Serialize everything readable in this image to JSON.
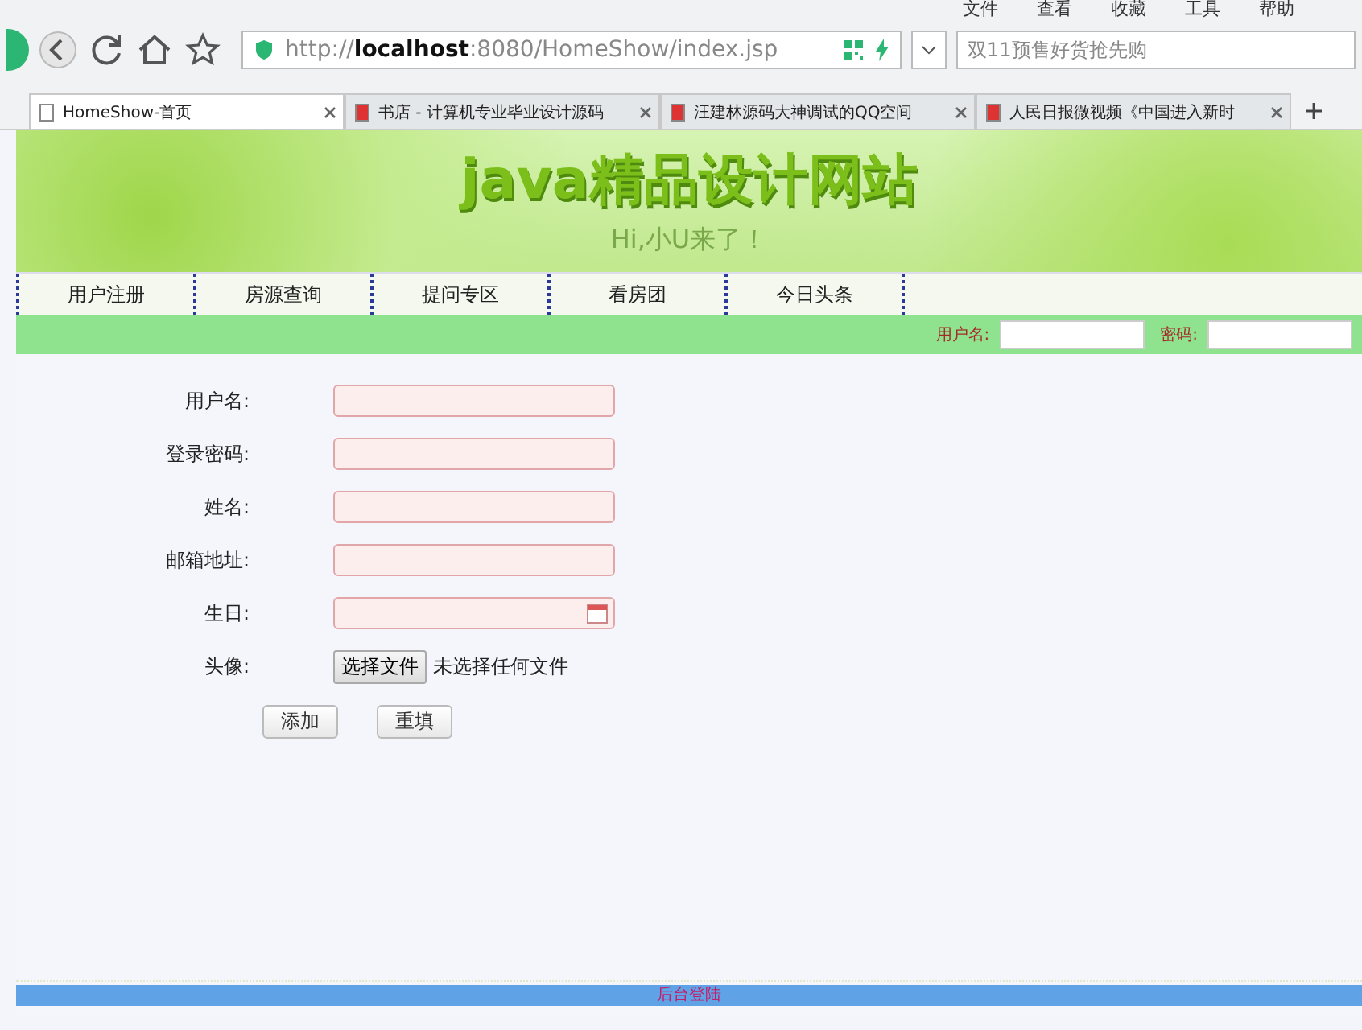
{
  "menu_bar": [
    "文件",
    "查看",
    "收藏",
    "工具",
    "帮助"
  ],
  "address_bar": {
    "url": "http://**localhost**:8080/HomeShow/index.jsp"
  },
  "search": {
    "placeholder": "双11预售好货抢先购"
  },
  "tabs": [
    {
      "label": "HomeShow-首页",
      "selected": true
    },
    {
      "label": "书店 - 计算机专业毕业设计源码",
      "selected": false
    },
    {
      "label": "汪建林源码大神调试的QQ空间",
      "selected": false
    },
    {
      "label": "人民日报微视频《中国进入新时",
      "selected": false
    }
  ],
  "banner": {
    "title": "java精品设计网站",
    "subtitle": "Hi,小U来了！"
  },
  "nav": [
    "用户注册",
    "房源查询",
    "提问专区",
    "看房团",
    "今日头条"
  ],
  "login_bar": {
    "username_label": "用户名:",
    "password_label": "密码:"
  },
  "form": {
    "fields": [
      {
        "kind": "text",
        "label": "用户名:"
      },
      {
        "kind": "text",
        "label": "登录密码:"
      },
      {
        "kind": "text",
        "label": "姓名:"
      },
      {
        "kind": "text",
        "label": "邮箱地址:"
      },
      {
        "kind": "date",
        "label": "生日:"
      },
      {
        "kind": "file",
        "label": "头像:",
        "button": "选择文件",
        "status": "未选择任何文件"
      }
    ],
    "buttons": [
      "添加",
      "重填"
    ]
  },
  "footer": {
    "link": "后台登陆"
  }
}
